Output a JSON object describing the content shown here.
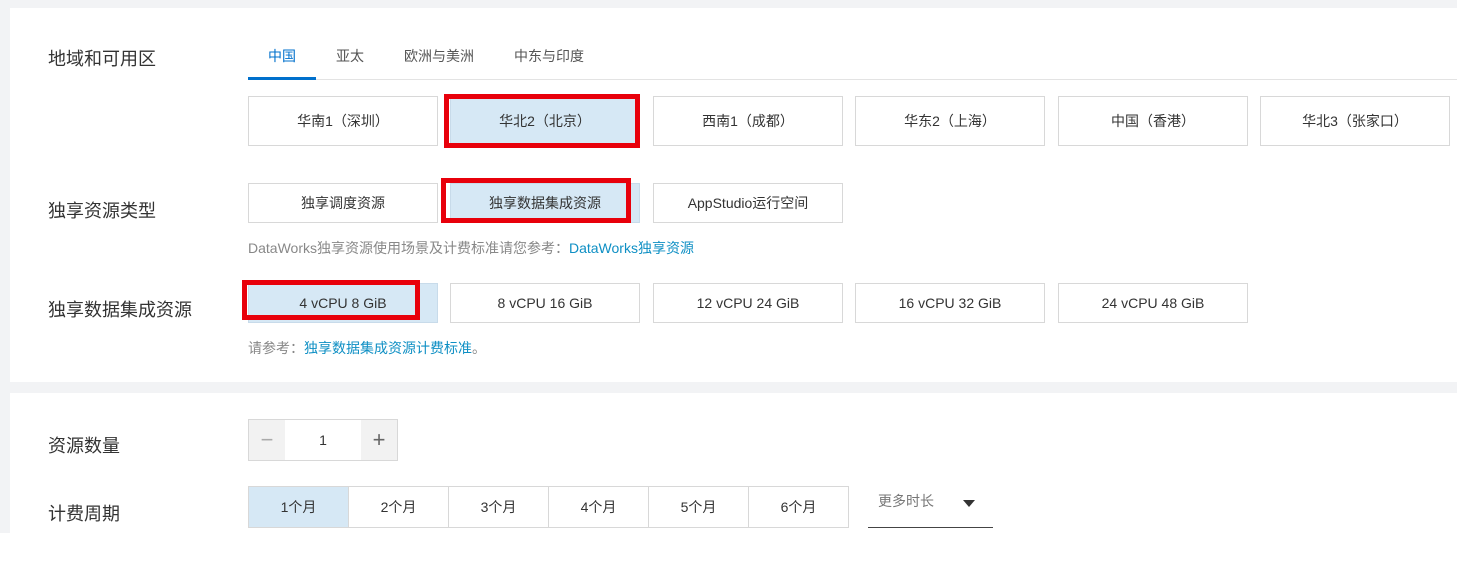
{
  "region": {
    "label": "地域和可用区",
    "tabs": [
      "中国",
      "亚太",
      "欧洲与美洲",
      "中东与印度"
    ],
    "active_tab": "中国",
    "options": [
      "华南1（深圳）",
      "华北2（北京）",
      "西南1（成都）",
      "华东2（上海）",
      "中国（香港）",
      "华北3（张家口）"
    ],
    "selected": "华北2（北京）"
  },
  "resource_type": {
    "label": "独享资源类型",
    "options": [
      "独享调度资源",
      "独享数据集成资源",
      "AppStudio运行空间"
    ],
    "selected": "独享数据集成资源",
    "hint_prefix": "DataWorks独享资源使用场景及计费标准请您参考：",
    "hint_link": "DataWorks独享资源"
  },
  "integration_resource": {
    "label": "独享数据集成资源",
    "options": [
      "4 vCPU 8 GiB",
      "8 vCPU 16 GiB",
      "12 vCPU 24 GiB",
      "16 vCPU 32 GiB",
      "24 vCPU 48 GiB"
    ],
    "selected": "4 vCPU 8 GiB",
    "hint_prefix": "请参考：",
    "hint_link": "独享数据集成资源计费标准",
    "hint_suffix": "。"
  },
  "quantity": {
    "label": "资源数量",
    "value": "1",
    "minus": "−",
    "plus": "+"
  },
  "billing": {
    "label": "计费周期",
    "periods": [
      "1个月",
      "2个月",
      "3个月",
      "4个月",
      "5个月",
      "6个月"
    ],
    "selected": "1个月",
    "more": "更多时长"
  },
  "colors": {
    "accent": "#0070cc",
    "selected_bg": "#d6e8f5",
    "highlight": "#e8000b",
    "link": "#0e8fc4"
  }
}
